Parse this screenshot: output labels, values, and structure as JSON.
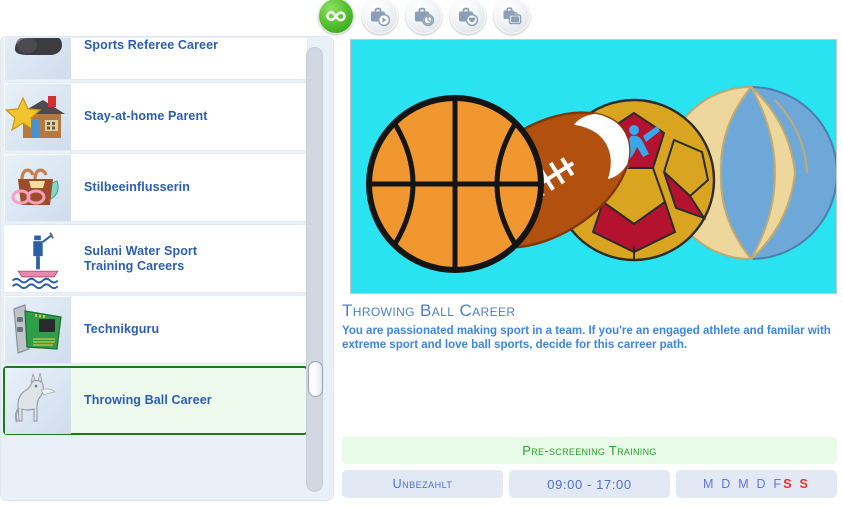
{
  "toolbar": {
    "buttons": [
      {
        "name": "all-careers-tab",
        "icon": "infinity-icon",
        "label": "All",
        "active": true
      },
      {
        "name": "active-careers-tab",
        "icon": "briefcase-play-icon",
        "label": "Active Careers",
        "active": false
      },
      {
        "name": "parttime-careers-tab",
        "icon": "briefcase-clock-icon",
        "label": "Part-Time Careers",
        "active": false
      },
      {
        "name": "favorite-careers-tab",
        "icon": "briefcase-heart-icon",
        "label": "Favorite Careers",
        "active": false
      },
      {
        "name": "other-careers-tab",
        "icon": "briefcase-stack-icon",
        "label": "Other Careers",
        "active": false
      }
    ]
  },
  "sidebar": {
    "items": [
      {
        "label": "",
        "icon": "partial-orange-icon",
        "selected": false,
        "partial": true
      },
      {
        "label": "Sports Referee Career",
        "icon": "whistle-icon",
        "selected": false
      },
      {
        "label": "Stay-at-home Parent",
        "icon": "star-house-icon",
        "selected": false
      },
      {
        "label": "Stilbeeinflusserin",
        "icon": "handbag-sunglasses-icon",
        "selected": false
      },
      {
        "label": "Sulani Water Sport\nTraining Careers",
        "icon": "paddleboarder-icon",
        "selected": false
      },
      {
        "label": "Technikguru",
        "icon": "graphics-card-icon",
        "selected": false
      },
      {
        "label": "Throwing Ball Career",
        "icon": "llama-statue-icon",
        "selected": true
      }
    ]
  },
  "detail": {
    "hero_icon": "sports-balls-image",
    "hero_background": "#2ae3f0",
    "title": "Throwing Ball Career",
    "description": "You are passionated making sport in a team. If you're an engaged athlete and familar with extreme sport and love ball sports, decide for this carreer path.",
    "section_header": "Pre-screening Training",
    "pay": "Unbezahlt",
    "hours": "09:00 - 17:00",
    "days": {
      "weekday": [
        "M",
        "D",
        "M",
        "D",
        "F"
      ],
      "weekend": [
        "S",
        "S"
      ]
    }
  },
  "colors": {
    "accent_blue": "#2a5eb0",
    "title_blue": "#4d7fc4",
    "desc_blue": "#3d86e0",
    "selected_border": "#1f7a1f",
    "selected_bg": "#effaef",
    "header_green": "#29a329",
    "weekend_red": "#e8342a",
    "active_tab_green": "#5cc436"
  }
}
